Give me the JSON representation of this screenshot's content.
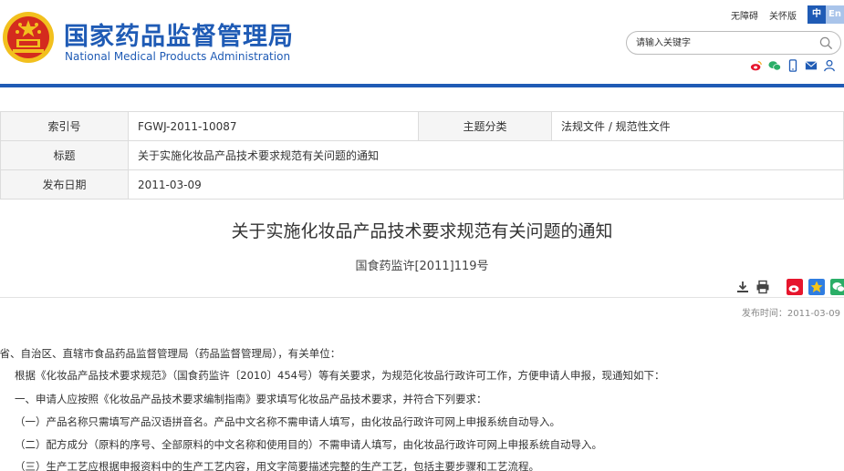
{
  "header": {
    "title_cn": "国家药品监督管理局",
    "title_en": "National Medical Products Administration",
    "links": [
      "无障碍",
      "关怀版"
    ],
    "lang": {
      "cn": "中",
      "en": "En"
    },
    "search_placeholder": "请输入关键字",
    "colors": {
      "brand": "#1f5bb5",
      "emblem_red": "#d42b1e",
      "emblem_gold": "#f2c01e"
    }
  },
  "social_icons": [
    "weibo-icon",
    "wechat-icon",
    "mobile-icon",
    "mail-icon",
    "user-icon"
  ],
  "info": {
    "index_label": "索引号",
    "index_value": "FGWJ-2011-10087",
    "category_label": "主题分类",
    "category_value": "法规文件 / 规范性文件",
    "title_label": "标题",
    "title_value": "关于实施化妆品产品技术要求规范有关问题的通知",
    "date_label": "发布日期",
    "date_value": "2011-03-09"
  },
  "document": {
    "title": "关于实施化妆品产品技术要求规范有关问题的通知",
    "number": "国食药监许[2011]119号",
    "publish_time": "发布时间：2011-03-09",
    "paragraphs": [
      "各省、自治区、直辖市食品药品监督管理局（药品监督管理局），有关单位：",
      "根据《化妆品产品技术要求规范》（国食药监许〔2010〕454号）等有关要求，为规范化妆品行政许可工作，方便申请人申报，现通知如下：",
      "一、申请人应按照《化妆品产品技术要求编制指南》要求填写化妆品产品技术要求，并符合下列要求：",
      "（一）产品名称只需填写产品汉语拼音名。产品中文名称不需申请人填写，由化妆品行政许可网上申报系统自动导入。",
      "（二）配方成分（原料的序号、全部原料的中文名称和使用目的）不需申请人填写，由化妆品行政许可网上申报系统自动导入。",
      "（三）生产工艺应根据申报资料中的生产工艺内容，用文字简要描述完整的生产工艺，包括主要步骤和工艺流程。"
    ]
  },
  "tools": [
    "download-icon",
    "print-icon",
    "share-weibo-icon",
    "share-qzone-icon",
    "share-wechat-icon"
  ]
}
